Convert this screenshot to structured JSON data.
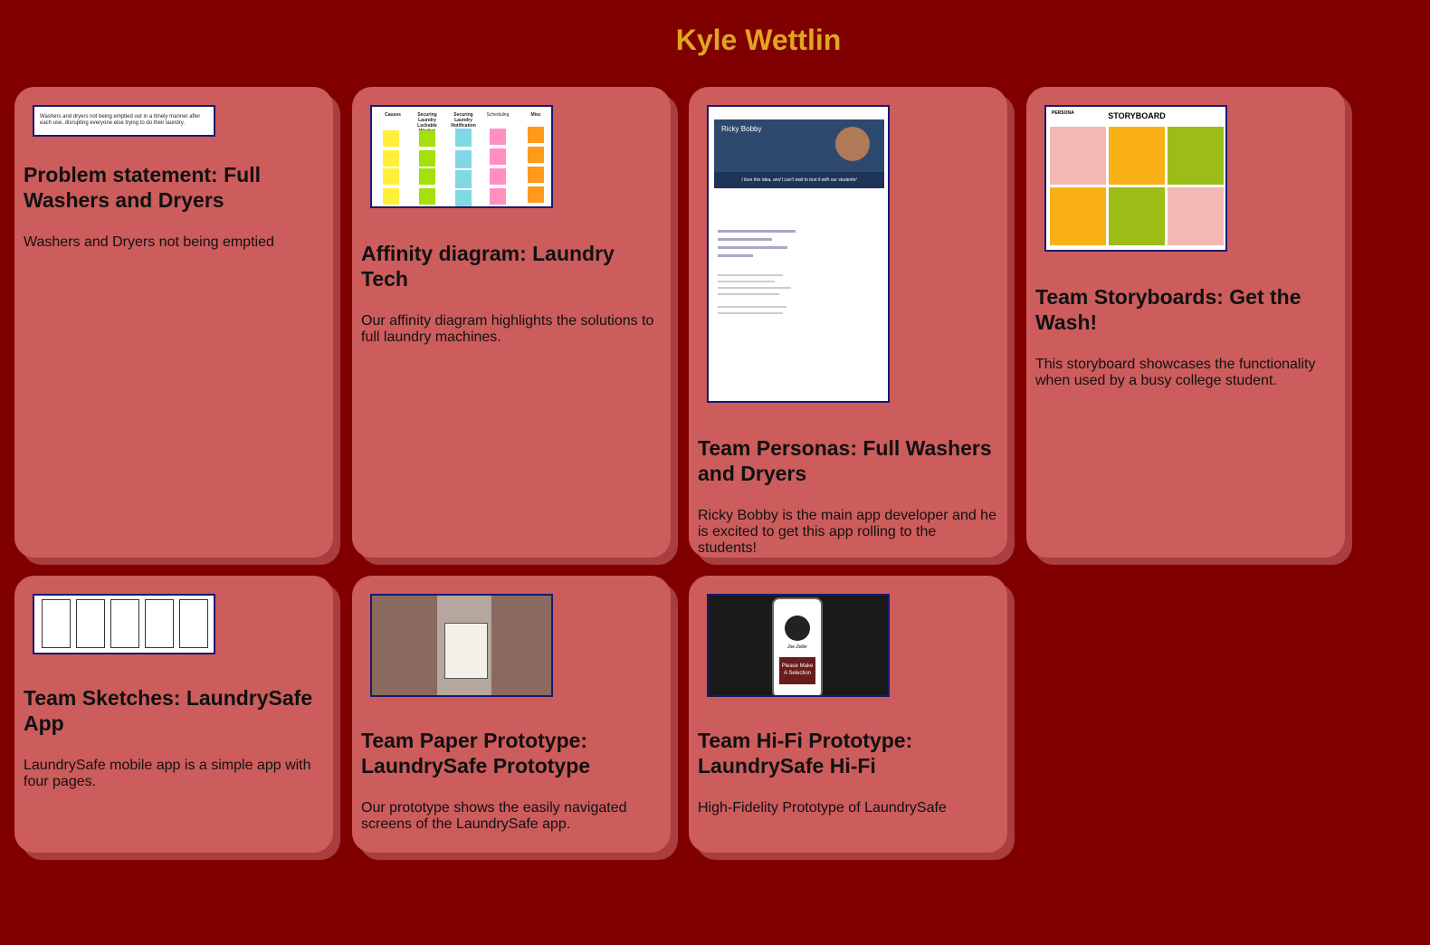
{
  "header": {
    "title": "Kyle Wettlin"
  },
  "cards": [
    {
      "title": "Problem statement: Full Washers and Dryers",
      "description": "Washers and Dryers not being emptied",
      "thumb_text": "Washers and dryers not being emptied out in a timely manner after each use, disrupting everyone else trying to do their laundry."
    },
    {
      "title": "Affinity diagram: Laundry Tech",
      "description": "Our affinity diagram highlights the solutions to full laundry machines.",
      "thumb_columns": [
        "Causes",
        "Securing Laundry Lockable Washer",
        "Securing Laundry Notification",
        "Scheduling",
        "Misc"
      ]
    },
    {
      "title": "Team Personas: Full Washers and Dryers",
      "description": "Ricky Bobby is the main app developer and he is excited to get this app rolling to the students!",
      "thumb_name": "Ricky Bobby",
      "thumb_quote": "I love this idea, and I can't wait to test it with our students!"
    },
    {
      "title": "Team Storyboards: Get the Wash!",
      "description": "This storyboard showcases the functionality when used by a busy college student.",
      "thumb_heading": "STORYBOARD",
      "thumb_persona": "PERSONA"
    },
    {
      "title": "Team Sketches: LaundrySafe App",
      "description": "LaundrySafe mobile app is a simple app with four pages."
    },
    {
      "title": "Team Paper Prototype: LaundrySafe Prototype",
      "description": "Our prototype shows the easily navigated screens of the LaundrySafe app."
    },
    {
      "title": "Team Hi-Fi Prototype: LaundrySafe Hi-Fi",
      "description": "High-Fidelity Prototype of LaundrySafe",
      "thumb_button": "Please Make A Selection",
      "thumb_name": "Joe Zeller"
    }
  ],
  "colors": {
    "background": "#800000",
    "card": "#cd5c5c",
    "title": "#e0a423"
  }
}
